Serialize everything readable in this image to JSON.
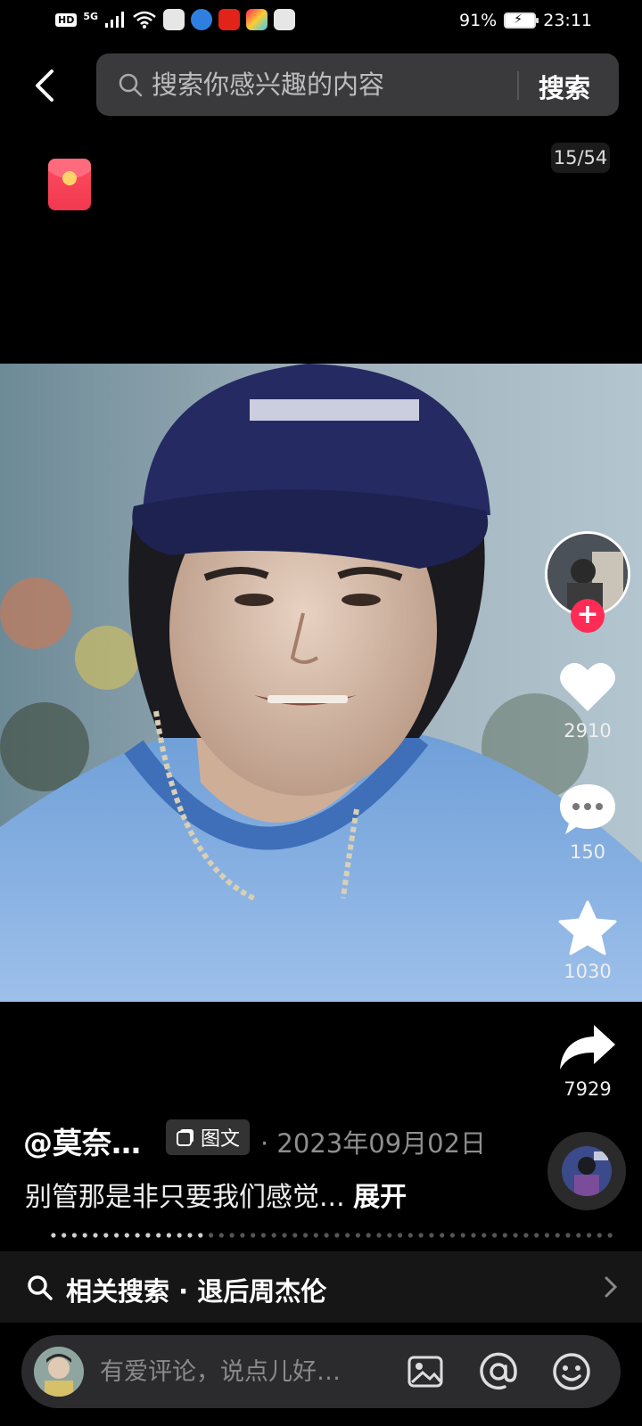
{
  "status_bar": {
    "hd": "HD",
    "network": "5G",
    "battery": "91%",
    "time": "23:11"
  },
  "search": {
    "placeholder": "搜索你感兴趣的内容",
    "button_label": "搜索"
  },
  "counter": "15/54",
  "actions": {
    "likes": "2910",
    "comments": "150",
    "favorites": "1030",
    "shares": "7929"
  },
  "post": {
    "author": "@莫奈…",
    "type_tag": "图文",
    "date": "· 2023年09月02日",
    "caption": "别管那是非只要我们感觉...",
    "expand_label": "展开"
  },
  "related_search": {
    "text": "相关搜索 · 退后周杰伦"
  },
  "comment": {
    "placeholder": "有爱评论，说点儿好…"
  },
  "colors": {
    "accent_red": "#fe2c55",
    "search_bg": "#3a3a3c",
    "comment_bg": "#2b2b2d"
  },
  "icons": {
    "back": "chevron-left-icon",
    "search": "search-icon",
    "like": "heart-icon",
    "comment": "comment-bubble-icon",
    "favorite": "star-icon",
    "share": "share-arrow-icon",
    "image": "image-icon",
    "mention": "at-icon",
    "emoji": "emoji-icon",
    "related_chevron": "chevron-right-icon"
  }
}
